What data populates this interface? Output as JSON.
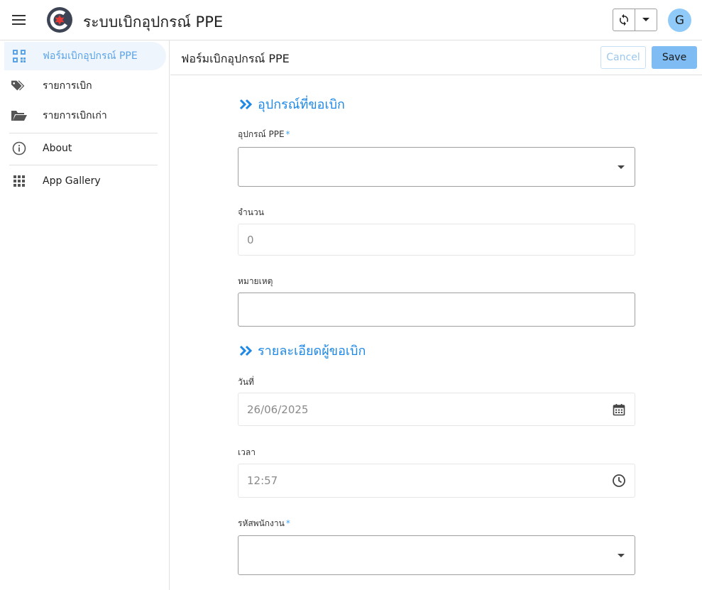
{
  "app": {
    "title": "ระบบเบิกอุปกรณ์ PPE",
    "avatar_initial": "G"
  },
  "icons": {
    "menu": "menu-icon",
    "logo": "app-logo",
    "sync": "sync-icon",
    "dropdown": "chevron-down-icon"
  },
  "sidebar": {
    "items": [
      {
        "label": "ฟอร์มเบิกอุปกรณ์ PPE",
        "icon": "qr-code-icon",
        "active": true
      },
      {
        "label": "รายการเบิก",
        "icon": "tags-icon",
        "active": false
      },
      {
        "label": "รายการเบิกเก่า",
        "icon": "folder-open-icon",
        "active": false
      },
      {
        "label": "About",
        "icon": "info-icon",
        "active": false
      },
      {
        "label": "App Gallery",
        "icon": "grid-icon",
        "active": false
      }
    ]
  },
  "form": {
    "title": "ฟอร์มเบิกอุปกรณ์ PPE",
    "cancel_label": "Cancel",
    "save_label": "Save",
    "sections": [
      {
        "title": "อุปกรณ์ที่ขอเบิก"
      },
      {
        "title": "รายละเอียดผู้ขอเบิก"
      }
    ],
    "fields": {
      "equipment": {
        "label": "อุปกรณ์ PPE",
        "required_mark": "*",
        "value": ""
      },
      "quantity": {
        "label": "จำนวน",
        "value": "0"
      },
      "note": {
        "label": "หมายเหตุ",
        "value": ""
      },
      "date": {
        "label": "วันที่",
        "value": "26/06/2025"
      },
      "time": {
        "label": "เวลา",
        "value": "12:57"
      },
      "employee_id": {
        "label": "รหัสพนักงาน",
        "required_mark": "*",
        "value": ""
      }
    }
  },
  "colors": {
    "accent": "#1e88e5",
    "active_nav_bg": "#eef5fd",
    "save_bg": "#7fbcf3"
  }
}
